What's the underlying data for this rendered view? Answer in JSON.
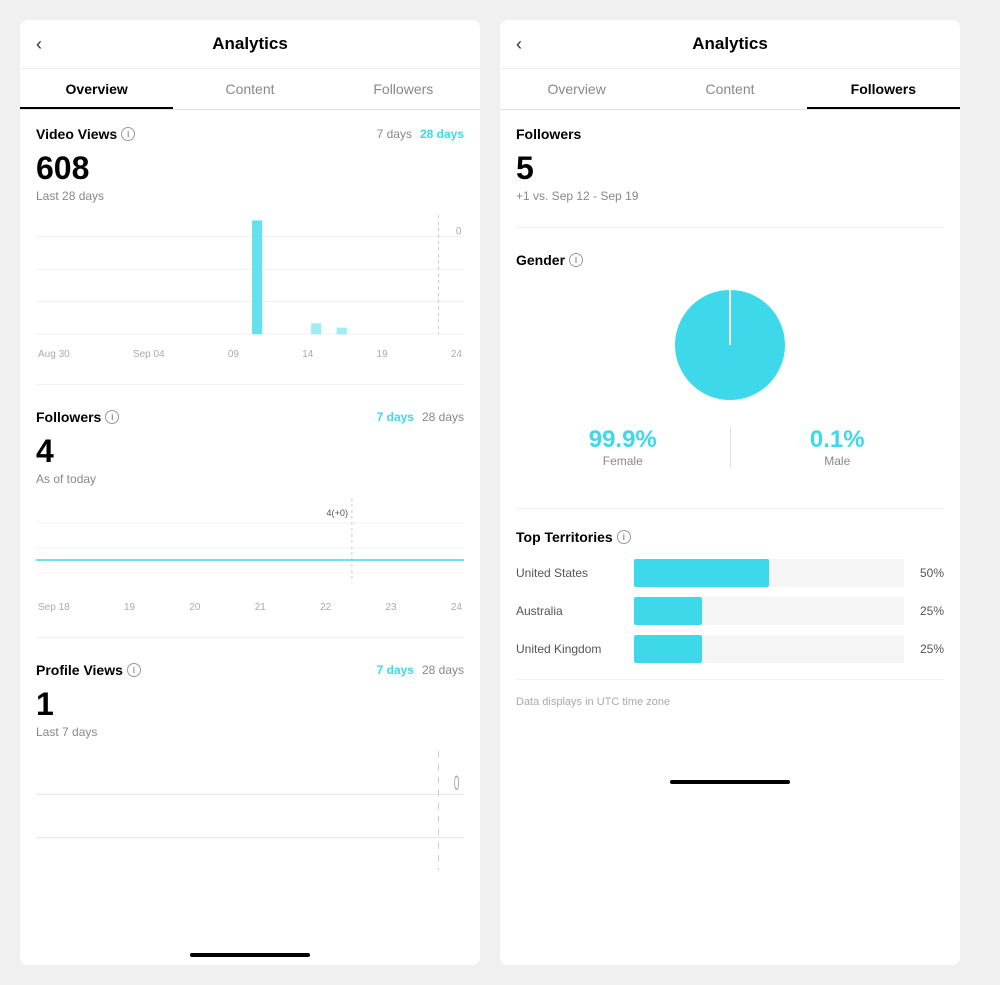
{
  "left_panel": {
    "header": {
      "back_label": "‹",
      "title": "Analytics"
    },
    "tabs": [
      {
        "id": "overview",
        "label": "Overview",
        "active": true
      },
      {
        "id": "content",
        "label": "Content",
        "active": false
      },
      {
        "id": "followers",
        "label": "Followers",
        "active": false
      }
    ],
    "video_views": {
      "title": "Video Views",
      "period_7": "7 days",
      "period_28": "28 days",
      "active_period": "28 days",
      "value": "608",
      "sub": "Last 28 days",
      "y_label": "0",
      "x_labels": [
        "Aug 30",
        "Sep 04",
        "09",
        "14",
        "19",
        "24"
      ]
    },
    "followers": {
      "title": "Followers",
      "period_7": "7 days",
      "period_28": "28 days",
      "active_period": "7 days",
      "value": "4",
      "sub": "As of today",
      "tooltip_label": "4(+0)",
      "x_labels": [
        "Sep 18",
        "19",
        "20",
        "21",
        "22",
        "23",
        "24"
      ]
    },
    "profile_views": {
      "title": "Profile Views",
      "period_7": "7 days",
      "period_28": "28 days",
      "active_period": "7 days",
      "value": "1",
      "sub": "Last 7 days",
      "y_label": "0"
    }
  },
  "right_panel": {
    "header": {
      "back_label": "‹",
      "title": "Analytics"
    },
    "tabs": [
      {
        "id": "overview",
        "label": "Overview",
        "active": false
      },
      {
        "id": "content",
        "label": "Content",
        "active": false
      },
      {
        "id": "followers",
        "label": "Followers",
        "active": true
      }
    ],
    "followers": {
      "title": "Followers",
      "value": "5",
      "change": "+1 vs. Sep 12 - Sep 19"
    },
    "gender": {
      "title": "Gender",
      "female_pct": "99.9%",
      "female_label": "Female",
      "male_pct": "0.1%",
      "male_label": "Male"
    },
    "territories": {
      "title": "Top Territories",
      "rows": [
        {
          "name": "United States",
          "pct": 50,
          "label": "50%"
        },
        {
          "name": "Australia",
          "pct": 25,
          "label": "25%"
        },
        {
          "name": "United Kingdom",
          "pct": 25,
          "label": "25%"
        }
      ]
    },
    "utc_note": "Data displays in UTC time zone"
  },
  "icons": {
    "info": "i",
    "back": "‹"
  },
  "colors": {
    "teal": "#3dd9eb",
    "black": "#000000",
    "gray_light": "#f0f0f0",
    "gray_text": "#888888"
  }
}
